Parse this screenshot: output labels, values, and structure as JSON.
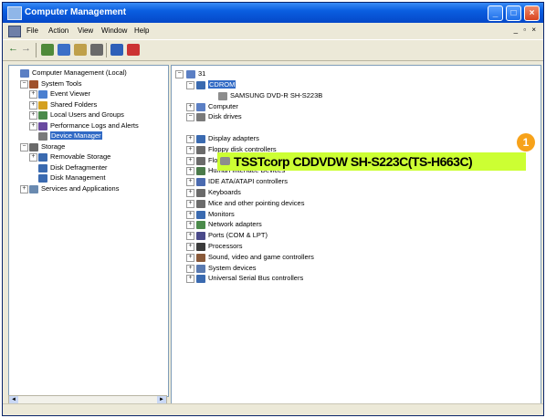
{
  "window": {
    "title": "Computer Management",
    "controls": {
      "minimize": "_",
      "maximize": "□",
      "close": "×"
    }
  },
  "menubar": {
    "items": [
      "File",
      "Action",
      "View",
      "Window",
      "Help"
    ],
    "mdi_controls": "_ ▫ ×"
  },
  "left_tree": [
    {
      "label": "Computer Management (Local)",
      "indent": 0,
      "expander": "",
      "icon": "computer-management-icon"
    },
    {
      "label": "System Tools",
      "indent": 1,
      "expander": "−",
      "icon": "system-tools-icon"
    },
    {
      "label": "Event Viewer",
      "indent": 2,
      "expander": "+",
      "icon": "event-viewer-icon"
    },
    {
      "label": "Shared Folders",
      "indent": 2,
      "expander": "+",
      "icon": "shared-folders-icon"
    },
    {
      "label": "Local Users and Groups",
      "indent": 2,
      "expander": "+",
      "icon": "users-icon"
    },
    {
      "label": "Performance Logs and Alerts",
      "indent": 2,
      "expander": "+",
      "icon": "performance-icon"
    },
    {
      "label": "Device Manager",
      "indent": 2,
      "expander": "",
      "icon": "device-manager-icon",
      "selected": true
    },
    {
      "label": "Storage",
      "indent": 1,
      "expander": "−",
      "icon": "storage-icon"
    },
    {
      "label": "Removable Storage",
      "indent": 2,
      "expander": "+",
      "icon": "removable-storage-icon"
    },
    {
      "label": "Disk Defragmenter",
      "indent": 2,
      "expander": "",
      "icon": "defrag-icon"
    },
    {
      "label": "Disk Management",
      "indent": 2,
      "expander": "",
      "icon": "disk-management-icon"
    },
    {
      "label": "Services and Applications",
      "indent": 1,
      "expander": "+",
      "icon": "services-icon"
    }
  ],
  "right_tree": {
    "root": "31",
    "items": [
      {
        "label": "CDROM",
        "expander": "−",
        "selected": true
      },
      {
        "label": "SAMSUNG DVD-R SH-S223B",
        "expander": "",
        "child": true
      },
      {
        "label": "Computer",
        "expander": "+"
      },
      {
        "label": "Disk drives",
        "expander": "−"
      },
      {
        "label": "",
        "expander": "",
        "child": true,
        "placeholder": true
      },
      {
        "label": "Display adapters",
        "expander": "+"
      },
      {
        "label": "Floppy disk controllers",
        "expander": "+"
      },
      {
        "label": "Floppy disk drives",
        "expander": "+"
      },
      {
        "label": "Human Interface Devices",
        "expander": "+"
      },
      {
        "label": "IDE ATA/ATAPI controllers",
        "expander": "+"
      },
      {
        "label": "Keyboards",
        "expander": "+"
      },
      {
        "label": "Mice and other pointing devices",
        "expander": "+"
      },
      {
        "label": "Monitors",
        "expander": "+"
      },
      {
        "label": "Network adapters",
        "expander": "+"
      },
      {
        "label": "Ports (COM & LPT)",
        "expander": "+"
      },
      {
        "label": "Processors",
        "expander": "+"
      },
      {
        "label": "Sound, video and game controllers",
        "expander": "+"
      },
      {
        "label": "System devices",
        "expander": "+"
      },
      {
        "label": "Universal Serial Bus controllers",
        "expander": "+"
      }
    ]
  },
  "highlight": {
    "text": "TSSTcorp CDDVDW  SH-S223C(TS-H663C)",
    "color": "#ccff33"
  },
  "callout": {
    "number": "1",
    "color": "#f7a21a"
  },
  "scrollbar": {
    "left_arrow": "◄",
    "right_arrow": "►"
  }
}
